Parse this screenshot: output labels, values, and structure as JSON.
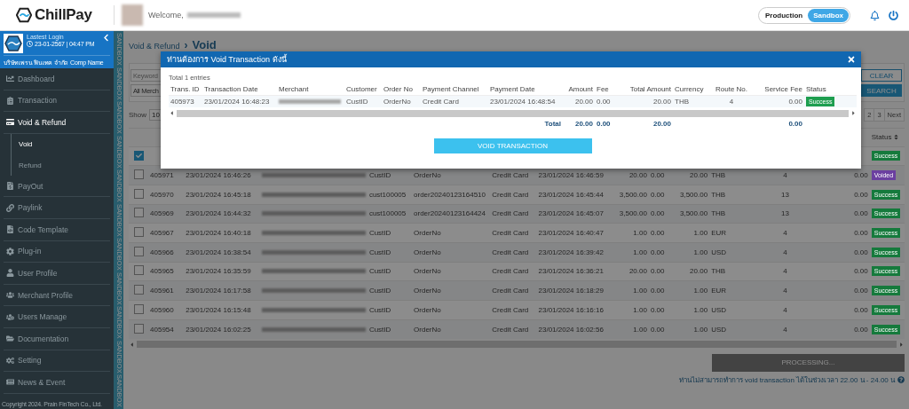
{
  "topbar": {
    "logo": "ChillPay",
    "welcome": "Welcome,",
    "env_toggle": [
      {
        "label": "Production",
        "selected": false
      },
      {
        "label": "Sandbox",
        "selected": true
      }
    ]
  },
  "sidebar": {
    "last_login_label": "Lastest Login",
    "last_login": "23-01-2567 | 04:47 PM",
    "company": "บริษัทเพรน ฟินเทค จำกัด Comp Name",
    "menu": [
      {
        "label": "Dashboard",
        "selected": false
      },
      {
        "label": "Transaction",
        "selected": false
      },
      {
        "label": "Void & Refund",
        "selected": true,
        "expanded": true,
        "children": [
          {
            "label": "Void",
            "selected": true
          },
          {
            "label": "Refund",
            "selected": false
          }
        ]
      },
      {
        "label": "PayOut",
        "selected": false
      },
      {
        "label": "Paylink",
        "selected": false
      },
      {
        "label": "Code Template",
        "selected": false
      },
      {
        "label": "Plug-in",
        "selected": false
      },
      {
        "label": "User Profile",
        "selected": false
      },
      {
        "label": "Merchant Profile",
        "selected": false
      },
      {
        "label": "Users Manage",
        "selected": false
      },
      {
        "label": "Documentation",
        "selected": false
      },
      {
        "label": "Setting",
        "selected": false
      },
      {
        "label": "News & Event",
        "selected": false
      }
    ],
    "copyright": "Copyright 2024. Prain FinTech Co., Ltd."
  },
  "sandbox_stripe": [
    "SANDBOX",
    "SANDBOX",
    "SANDBOX",
    "SANDBOX",
    "SANDBOX",
    "SANDBOX",
    "SANDBOX",
    "SANDBOX",
    "SANDBOX",
    "SANDBOX",
    "SANDBOX"
  ],
  "breadcrumb": {
    "parent": "Void & Refund",
    "separator": "›",
    "current": "Void"
  },
  "filters": {
    "keyword": {
      "placeholder": "Keyword"
    },
    "merchant_select": "All Merch",
    "clear_button": "CLEAR",
    "search_button": "SEARCH"
  },
  "table": {
    "show_label": "Show",
    "page_size": "10",
    "pagination": [
      "2",
      "3",
      "Next"
    ],
    "status_header": "Status",
    "rows": [
      {
        "checked": true,
        "status": "Success",
        "color": "#157a3c"
      },
      {
        "checked": false,
        "id": "405971",
        "date": "23/01/2024 16:46:26",
        "customer": "CustID",
        "order": "OrderNo",
        "channel": "Credit Card",
        "pay_date": "23/01/2024 16:46:59",
        "amount": "20.00",
        "fee": "0.00",
        "total": "20.00",
        "currency": "THB",
        "route": "4",
        "service_fee": "0.00",
        "status": "Voided",
        "color": "#6b3fa0"
      },
      {
        "checked": false,
        "id": "405970",
        "date": "23/01/2024 16:45:18",
        "customer": "cust100005",
        "order": "order20240123164510",
        "channel": "Credit Card",
        "pay_date": "23/01/2024 16:45:44",
        "amount": "3,500.00",
        "fee": "0.00",
        "total": "3,500.00",
        "currency": "THB",
        "route": "13",
        "service_fee": "0.00",
        "status": "Success",
        "color": "#157a3c"
      },
      {
        "checked": false,
        "id": "405969",
        "date": "23/01/2024 16:44:32",
        "customer": "cust100005",
        "order": "order20240123164424",
        "channel": "Credit Card",
        "pay_date": "23/01/2024 16:45:07",
        "amount": "3,500.00",
        "fee": "0.00",
        "total": "3,500.00",
        "currency": "THB",
        "route": "13",
        "service_fee": "0.00",
        "status": "Success",
        "color": "#157a3c"
      },
      {
        "checked": false,
        "id": "405967",
        "date": "23/01/2024 16:40:18",
        "customer": "CustID",
        "order": "OrderNo",
        "channel": "Credit Card",
        "pay_date": "23/01/2024 16:40:47",
        "amount": "1.00",
        "fee": "0.00",
        "total": "1.00",
        "currency": "EUR",
        "route": "4",
        "service_fee": "0.00",
        "status": "Success",
        "color": "#157a3c"
      },
      {
        "checked": false,
        "id": "405966",
        "date": "23/01/2024 16:38:54",
        "customer": "CustID",
        "order": "OrderNo",
        "channel": "Credit Card",
        "pay_date": "23/01/2024 16:39:42",
        "amount": "1.00",
        "fee": "0.00",
        "total": "1.00",
        "currency": "USD",
        "route": "4",
        "service_fee": "0.00",
        "status": "Success",
        "color": "#157a3c"
      },
      {
        "checked": false,
        "id": "405965",
        "date": "23/01/2024 16:35:59",
        "customer": "CustID",
        "order": "OrderNo",
        "channel": "Credit Card",
        "pay_date": "23/01/2024 16:36:21",
        "amount": "20.00",
        "fee": "0.00",
        "total": "20.00",
        "currency": "THB",
        "route": "4",
        "service_fee": "0.00",
        "status": "Success",
        "color": "#157a3c"
      },
      {
        "checked": false,
        "id": "405961",
        "date": "23/01/2024 16:17:58",
        "customer": "CustID",
        "order": "OrderNo",
        "channel": "Credit Card",
        "pay_date": "23/01/2024 16:18:29",
        "amount": "1.00",
        "fee": "0.00",
        "total": "1.00",
        "currency": "EUR",
        "route": "4",
        "service_fee": "0.00",
        "status": "Success",
        "color": "#157a3c"
      },
      {
        "checked": false,
        "id": "405960",
        "date": "23/01/2024 16:15:48",
        "customer": "CustID",
        "order": "OrderNo",
        "channel": "Credit Card",
        "pay_date": "23/01/2024 16:16:16",
        "amount": "1.00",
        "fee": "0.00",
        "total": "1.00",
        "currency": "USD",
        "route": "4",
        "service_fee": "0.00",
        "status": "Success",
        "color": "#157a3c"
      },
      {
        "checked": false,
        "id": "405954",
        "date": "23/01/2024 16:02:25",
        "customer": "CustID",
        "order": "OrderNo",
        "channel": "Credit Card",
        "pay_date": "23/01/2024 16:02:56",
        "amount": "1.00",
        "fee": "0.00",
        "total": "1.00",
        "currency": "USD",
        "route": "4",
        "service_fee": "0.00",
        "status": "Success",
        "color": "#157a3c"
      }
    ]
  },
  "processing_button": "PROCESSING...",
  "note": "ท่านไม่สามารถทำการ void transaction ได้ในช่วงเวลา 22.00 น - 24.00 น",
  "modal": {
    "title": "ท่านต้องการ Void Transaction ดังนี้",
    "total_entries": "Total 1 entries",
    "columns": [
      "Trans. ID",
      "Transaction Date",
      "Merchant",
      "Customer",
      "Order No",
      "Payment Channel",
      "Payment Date",
      "Amount",
      "Fee",
      "Total Amount",
      "Currency",
      "Route No.",
      "Service Fee",
      "Status"
    ],
    "row": {
      "id": "405973",
      "date": "23/01/2024 16:48:23",
      "customer": "CustID",
      "order": "OrderNo",
      "channel": "Credit Card",
      "pay_date": "23/01/2024 16:48:54",
      "amount": "20.00",
      "fee": "0.00",
      "total": "20.00",
      "currency": "THB",
      "route": "4",
      "service_fee": "0.00",
      "status": "Success",
      "color": "#1e9e4f"
    },
    "totals": {
      "label": "Total",
      "amount": "20.00",
      "fee": "0.00",
      "total": "20.00",
      "service_fee": "0.00"
    },
    "button": "VOID TRANSACTION"
  }
}
